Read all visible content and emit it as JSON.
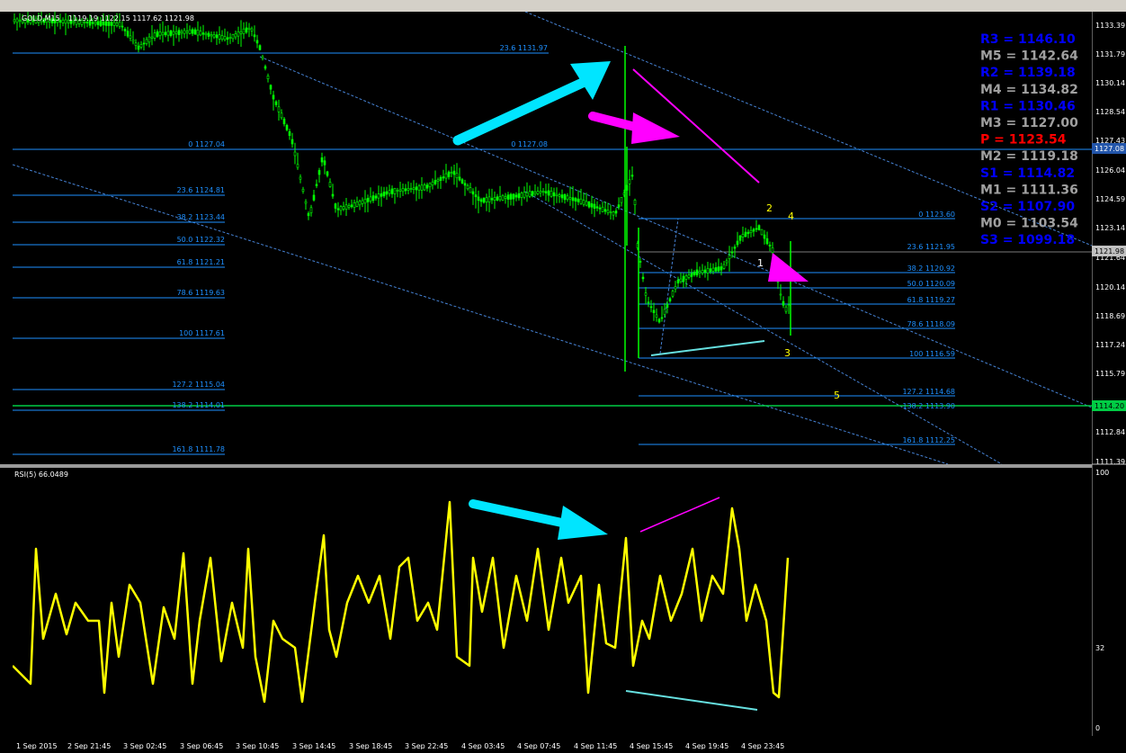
{
  "window": {
    "symbol_label": "GOLD,M15",
    "ohlc": "1119.19 1122.15 1117.62 1121.98"
  },
  "colors": {
    "background": "#000000",
    "candles": "#00ff00",
    "fib_lines": "#1e90ff",
    "channel": "#4682d4",
    "rsi_line": "#ffff00",
    "arrow_cyan": "#00e5ff",
    "arrow_magenta": "#ff00ff",
    "teal_line": "#66e0e0",
    "pivot_blue": "#0000ff",
    "pivot_gray": "#a0a0a0",
    "pivot_red": "#ff0000",
    "price_tag_current": "#c0c0c0",
    "price_tag_green": "#00cc44",
    "price_tag_blue": "#2255aa"
  },
  "price_axis": [
    "1133.39",
    "1131.79",
    "1130.14",
    "1128.54",
    "1127.43",
    "1126.04",
    "1124.59",
    "1123.14",
    "1121.98",
    "1121.64",
    "1120.14",
    "1118.69",
    "1117.24",
    "1115.79",
    "1114.20",
    "1112.84",
    "1111.39"
  ],
  "current_price": "1121.98",
  "green_level_price": "1114.20",
  "blue_tag_price": "1127.08",
  "pivots": [
    {
      "label": "R3 = 1146.10",
      "color": "blue"
    },
    {
      "label": "M5 = 1142.64",
      "color": "gray"
    },
    {
      "label": "R2 = 1139.18",
      "color": "blue"
    },
    {
      "label": "M4 = 1134.82",
      "color": "gray"
    },
    {
      "label": "R1 = 1130.46",
      "color": "blue"
    },
    {
      "label": "M3 = 1127.00",
      "color": "gray"
    },
    {
      "label": "P  = 1123.54",
      "color": "red"
    },
    {
      "label": "M2 = 1119.18",
      "color": "gray"
    },
    {
      "label": "S1 = 1114.82",
      "color": "blue"
    },
    {
      "label": "M1 = 1111.36",
      "color": "gray"
    },
    {
      "label": "S2 = 1107.90",
      "color": "blue"
    },
    {
      "label": "M0 = 1103.54",
      "color": "gray"
    },
    {
      "label": "S3 = 1099.18",
      "color": "blue"
    }
  ],
  "fib_left": [
    "23.6 1131.97",
    "0 1127.04",
    "23.6 1124.81",
    "38.2 1123.44",
    "50.0 1122.32",
    "61.8 1121.21",
    "78.6 1119.63",
    "100 1117.61",
    "127.2 1115.04",
    "138.2 1114.01",
    "161.8 1111.78"
  ],
  "fib_mid": "0 1127.08",
  "fib_right": [
    "0 1123.60",
    "23.6 1121.95",
    "38.2 1120.92",
    "50.0 1120.09",
    "61.8 1119.27",
    "78.6 1118.09",
    "100 1116.59",
    "127.2 1114.68",
    "138.2 1113.90",
    "161.8 1112.25"
  ],
  "wave_labels": [
    "1",
    "2",
    "3",
    "4",
    "5"
  ],
  "rsi": {
    "title": "RSI(5) 66.0489",
    "axis": [
      "100",
      "32",
      "0"
    ]
  },
  "time_axis": [
    "1 Sep 2015",
    "2 Sep 21:45",
    "3 Sep 02:45",
    "3 Sep 06:45",
    "3 Sep 10:45",
    "3 Sep 14:45",
    "3 Sep 18:45",
    "3 Sep 22:45",
    "4 Sep 03:45",
    "4 Sep 07:45",
    "4 Sep 11:45",
    "4 Sep 15:45",
    "4 Sep 19:45",
    "4 Sep 23:45"
  ]
}
